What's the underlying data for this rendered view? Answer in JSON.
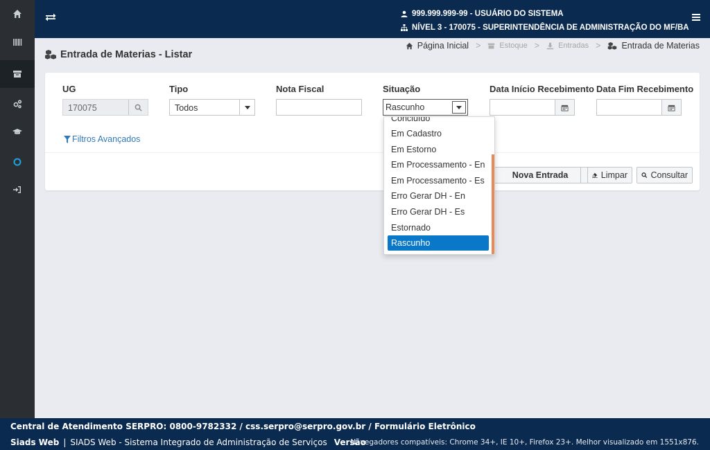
{
  "header": {
    "user_line": "999.999.999-99 - USUÁRIO DO SISTEMA",
    "level_line": "NÍVEL 3 - 170075 - SUPERINTENDÊNCIA DE ADMINISTRAÇÃO DO MF/BA"
  },
  "sidebar": {
    "items": [
      {
        "icon": "home-icon"
      },
      {
        "icon": "barcode-icon"
      },
      {
        "icon": "archive-icon",
        "active": true
      },
      {
        "icon": "cogs-icon"
      },
      {
        "icon": "graduation-cap-icon"
      },
      {
        "icon": "circle-icon",
        "color": "#1fa3e0"
      },
      {
        "icon": "sign-in-icon"
      }
    ]
  },
  "page": {
    "title": "Entrada de Materias - Listar"
  },
  "breadcrumb": {
    "home": "Página Inicial",
    "estoque": "Estoque",
    "entradas": "Entradas",
    "current": "Entrada de Materias",
    "separator": ">"
  },
  "filters": {
    "ug_label": "UG",
    "ug_value": "170075",
    "tipo_label": "Tipo",
    "tipo_value": "Todos",
    "nota_label": "Nota Fiscal",
    "nota_value": "",
    "situacao_label": "Situação",
    "situacao_value": "Rascunho",
    "data_inicio_label": "Data Início Recebimento",
    "data_inicio_value": "",
    "data_fim_label": "Data Fim Recebimento",
    "data_fim_value": "",
    "advanced_link": "Filtros Avançados"
  },
  "situacao_options": [
    "Concluído",
    "Em Cadastro",
    "Em Estorno",
    "Em Processamento - En",
    "Em Processamento - Es",
    "Erro Gerar DH - En",
    "Erro Gerar DH - Es",
    "Estornado",
    "Rascunho"
  ],
  "situacao_selected_index": 8,
  "actions": {
    "nova_entrada": "Nova Entrada",
    "limpar": "Limpar",
    "consultar": "Consultar"
  },
  "footer": {
    "line1": "Central de Atendimento SERPRO: 0800-9782332 / css.serpro@serpro.gov.br / Formulário Eletrônico",
    "app_name": "Siads Web",
    "app_desc": "SIADS Web - Sistema Integrado de Administração de Serviços",
    "version_label": "Versão",
    "compat": "Navegadores compatíveis: Chrome 34+, IE 10+, Firefox 23+. Melhor visualizado em 1551x876."
  },
  "colors": {
    "topbar": "#0b2a50",
    "sidebar": "#2b2f33",
    "accent": "#0a78c8",
    "link": "#3179b6"
  }
}
